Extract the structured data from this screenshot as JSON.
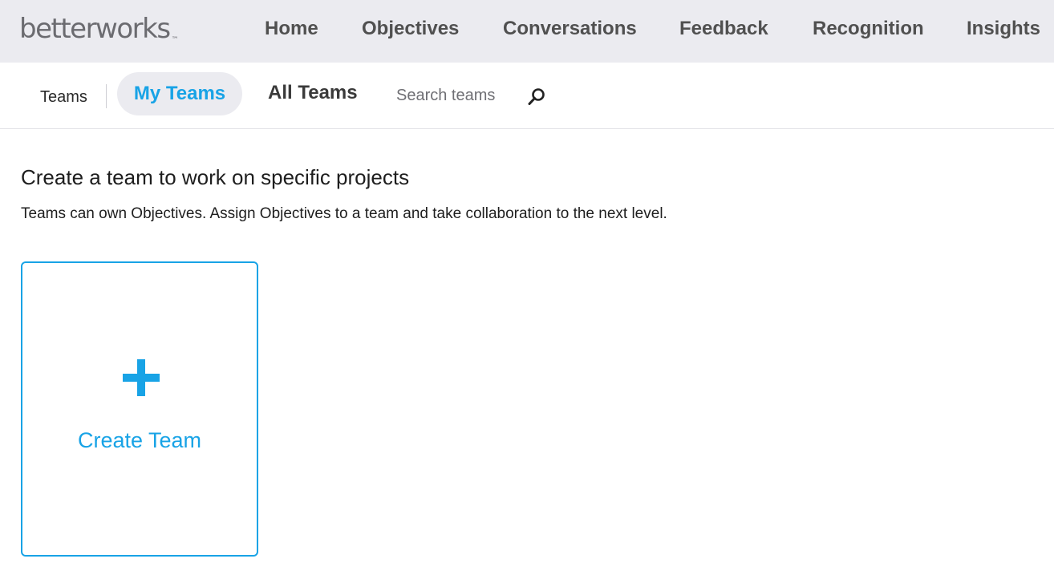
{
  "brand": {
    "logo_text": "betterworks",
    "trademark": "™"
  },
  "nav": {
    "items": [
      {
        "label": "Home"
      },
      {
        "label": "Objectives"
      },
      {
        "label": "Conversations"
      },
      {
        "label": "Feedback"
      },
      {
        "label": "Recognition"
      },
      {
        "label": "Insights"
      }
    ]
  },
  "subnav": {
    "section_label": "Teams",
    "tabs": [
      {
        "label": "My Teams",
        "active": true
      },
      {
        "label": "All Teams",
        "active": false
      }
    ],
    "search": {
      "placeholder": "Search teams",
      "value": "",
      "icon": "search-icon"
    }
  },
  "main": {
    "heading": "Create a team to work on specific projects",
    "description": "Teams can own Objectives. Assign Objectives to a team and take collaboration to the next level.",
    "create_card": {
      "icon": "plus-icon",
      "label": "Create Team"
    }
  },
  "colors": {
    "accent": "#18a3e6",
    "topbar_bg": "#ebebf0",
    "nav_text": "#505050"
  }
}
